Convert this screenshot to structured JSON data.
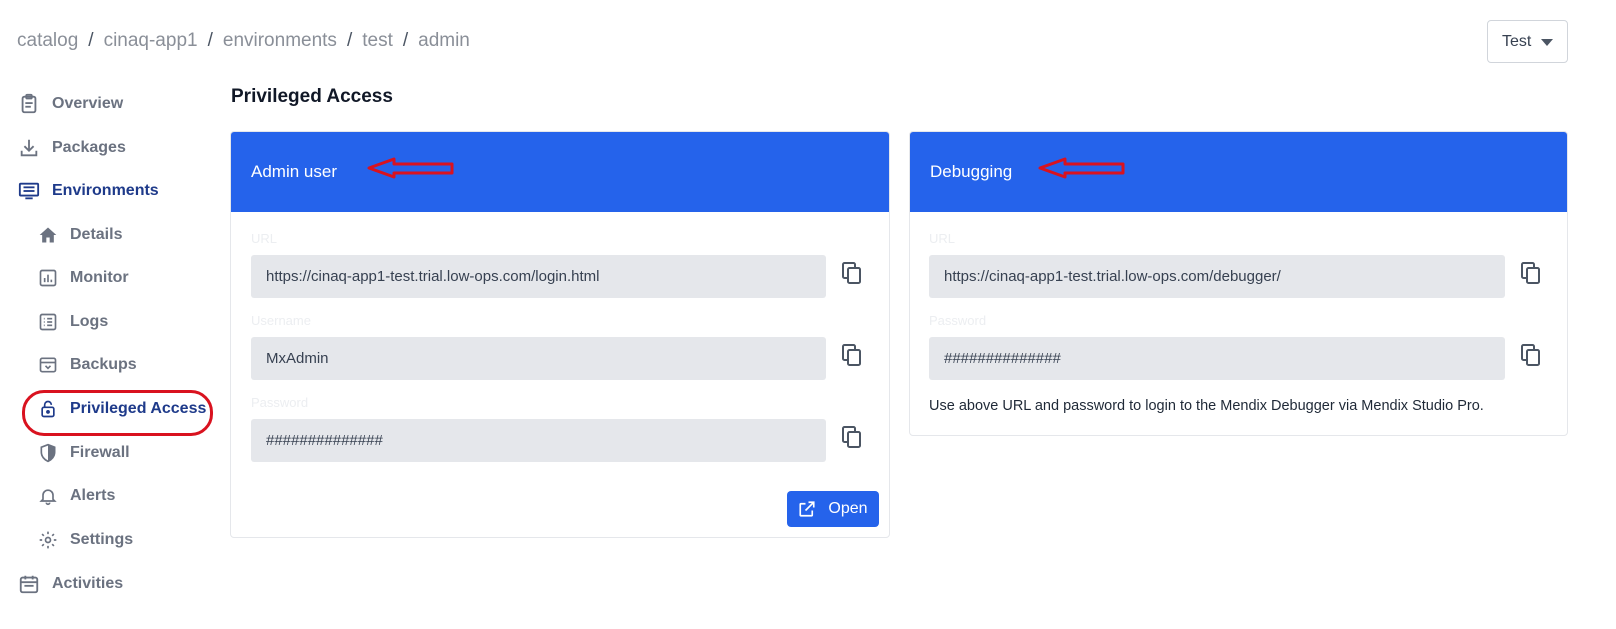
{
  "breadcrumb": [
    "catalog",
    "cinaq-app1",
    "environments",
    "test",
    "admin"
  ],
  "env_select": {
    "value": "Test"
  },
  "sidebar": {
    "overview": "Overview",
    "packages": "Packages",
    "environments": "Environments",
    "details": "Details",
    "monitor": "Monitor",
    "logs": "Logs",
    "backups": "Backups",
    "privileged_access": "Privileged Access",
    "firewall": "Firewall",
    "alerts": "Alerts",
    "settings": "Settings",
    "activities": "Activities"
  },
  "page": {
    "title": "Privileged Access"
  },
  "admin_card": {
    "title": "Admin user",
    "url_label": "URL",
    "url_value": "https://cinaq-app1-test.trial.low-ops.com/login.html",
    "username_label": "Username",
    "username_value": "MxAdmin",
    "password_label": "Password",
    "password_value": "##############",
    "open_label": "Open"
  },
  "debug_card": {
    "title": "Debugging",
    "url_label": "URL",
    "url_value": "https://cinaq-app1-test.trial.low-ops.com/debugger/",
    "password_label": "Password",
    "password_value": "##############",
    "help": "Use above URL and password to login to the Mendix Debugger via Mendix Studio Pro."
  },
  "colors": {
    "accent": "#2563eb",
    "active_nav": "#1e3a8a",
    "annotation": "#d9121f"
  },
  "icons": [
    "clipboard-icon",
    "download-icon",
    "monitor-list-icon",
    "home-icon",
    "chart-icon",
    "list-icon",
    "archive-icon",
    "lock-icon",
    "shield-icon",
    "bell-icon",
    "gear-icon",
    "calendar-icon",
    "copy-icon",
    "external-link-icon"
  ]
}
